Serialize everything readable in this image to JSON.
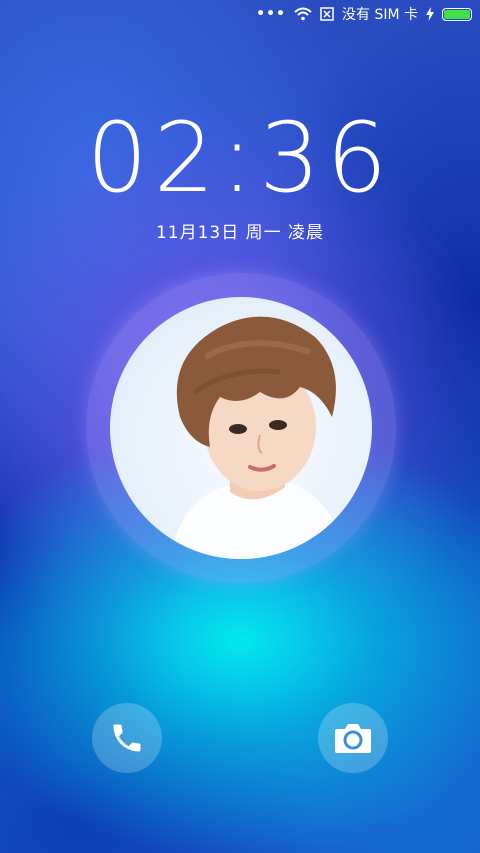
{
  "status_bar": {
    "signal_dots": "•••",
    "wifi_icon": "wifi-icon",
    "sim_icon": "no-sim-icon",
    "sim_text": "没有 SIM 卡",
    "charging_icon": "charging-bolt-icon",
    "battery_level": 1.0,
    "battery_color": "#3fe04a"
  },
  "lock_screen": {
    "time": "02:36",
    "date": "11月13日 周一 凌晨"
  },
  "avatar": {
    "description_icon": "user-portrait"
  },
  "shortcuts": {
    "left_icon": "phone-icon",
    "right_icon": "camera-icon"
  }
}
